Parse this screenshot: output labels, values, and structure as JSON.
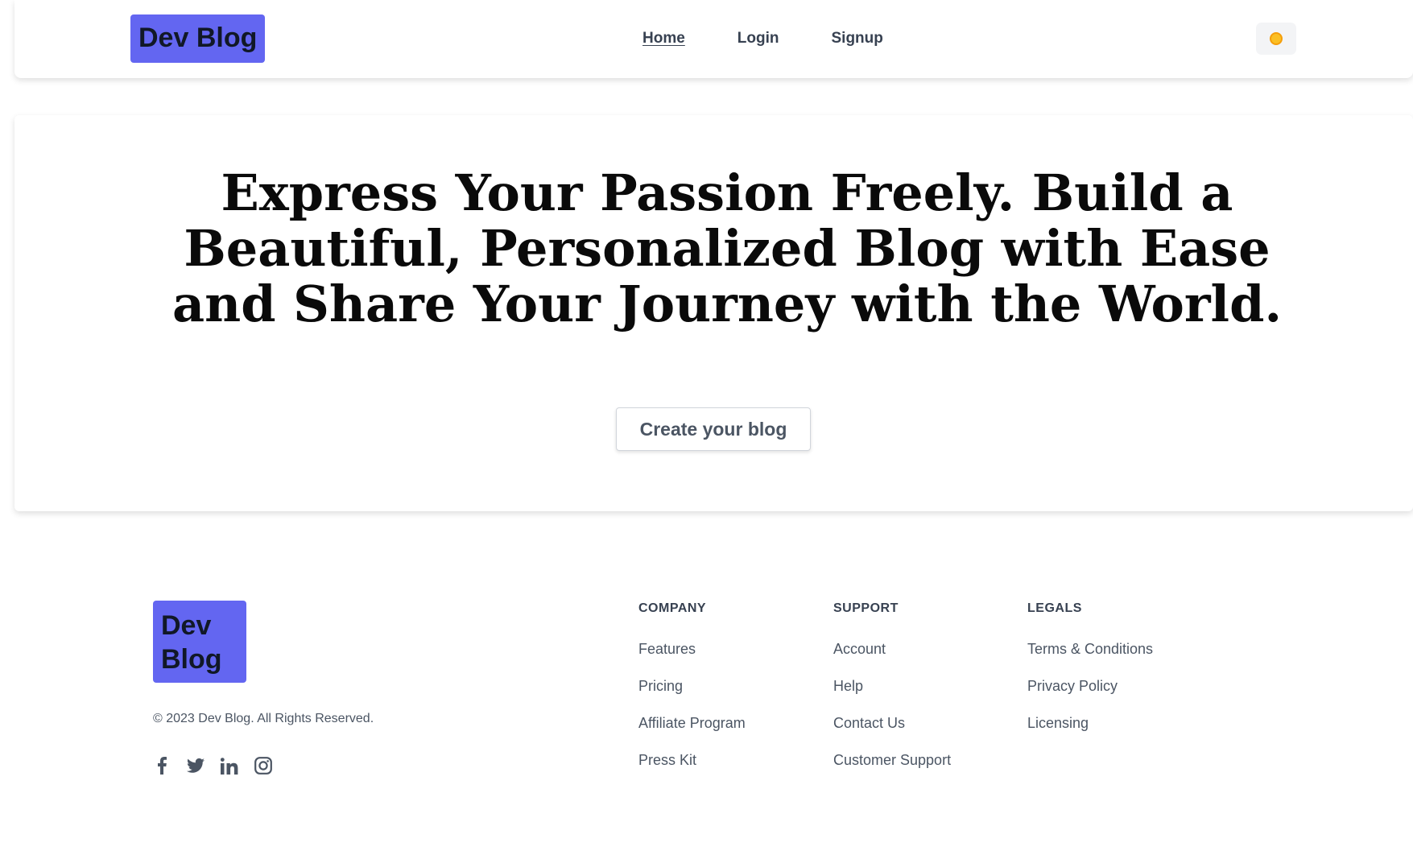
{
  "header": {
    "logo": "Dev Blog",
    "nav": [
      {
        "label": "Home",
        "active": true
      },
      {
        "label": "Login",
        "active": false
      },
      {
        "label": "Signup",
        "active": false
      }
    ],
    "theme_toggle_icon": "sun-icon"
  },
  "hero": {
    "headline": "Express Your Passion Freely. Build a Beautiful, Personalized Blog with Ease and Share Your Journey with the World.",
    "cta_label": "Create your blog"
  },
  "footer": {
    "logo": "Dev Blog",
    "copyright": "© 2023 Dev Blog. All Rights Reserved.",
    "socials": [
      "facebook-icon",
      "twitter-icon",
      "linkedin-icon",
      "instagram-icon"
    ],
    "columns": [
      {
        "title": "COMPANY",
        "links": [
          "Features",
          "Pricing",
          "Affiliate Program",
          "Press Kit"
        ]
      },
      {
        "title": "SUPPORT",
        "links": [
          "Account",
          "Help",
          "Contact Us",
          "Customer Support"
        ]
      },
      {
        "title": "LEGALS",
        "links": [
          "Terms & Conditions",
          "Privacy Policy",
          "Licensing"
        ]
      }
    ]
  },
  "colors": {
    "brand": "#6366f1",
    "text": "#111827",
    "muted": "#4b5563",
    "sun": "#fbbf24"
  }
}
